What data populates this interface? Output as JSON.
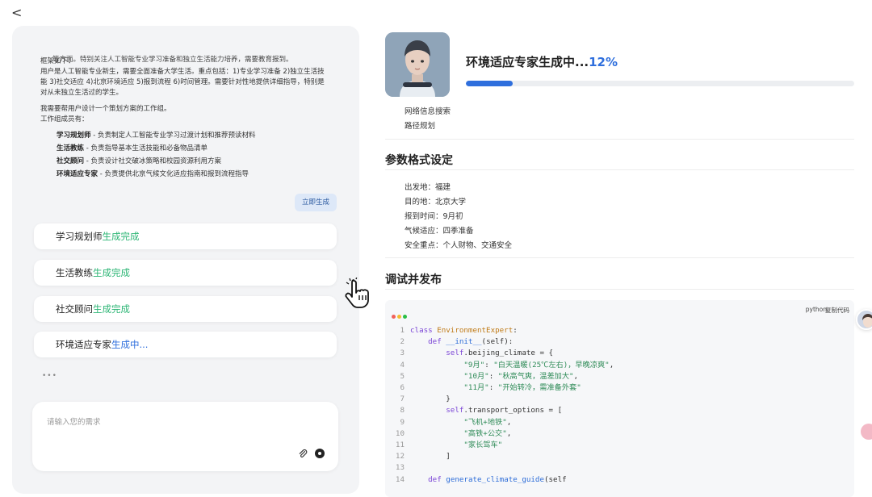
{
  "nav": {
    "back": "<"
  },
  "chat": {
    "cut_text": "等方面。特别关注人工智能专业学习准备和独立生活能力培养，需要教育报到。",
    "paragraphs": [
      "框架如下：\n用户是人工智能专业新生，需要全面准备大学生活。重点包括：1)专业学习准备 2)独立生活技能 3)社交适应 4)北京环境适应 5)报到流程 6)时间管理。需要针对性地提供详细指导，特别是对从未独立生活过的学生。",
      "我需要帮用户设计一个策划方案的工作组。\n工作组成员有："
    ],
    "members": [
      {
        "name": "学习规划师",
        "desc": " - 负责制定人工智能专业学习过渡计划和推荐预读材料"
      },
      {
        "name": "生活教练",
        "desc": " - 负责指导基本生活技能和必备物品清单"
      },
      {
        "name": "社交顾问",
        "desc": " - 负责设计社交破冰策略和校园资源利用方案"
      },
      {
        "name": "环境适应专家",
        "desc": " - 负责提供北京气候文化适应指南和报到流程指导"
      }
    ],
    "generate_button": "立即生成",
    "agents": [
      {
        "name": "学习规划师",
        "status": "生成完成",
        "state": "done"
      },
      {
        "name": "生活教练",
        "status": "生成完成",
        "state": "done"
      },
      {
        "name": "社交顾问",
        "status": "生成完成",
        "state": "done"
      },
      {
        "name": "环境适应专家",
        "status": "生成中...",
        "state": "running"
      }
    ],
    "typing": "•••",
    "input_placeholder": "请输入您的需求"
  },
  "progress": {
    "title": "环境适应专家生成中...",
    "percent_label": "12%",
    "value": 0.12,
    "tools": [
      "网络信息搜索",
      "路径规划"
    ]
  },
  "params": {
    "title": "参数格式设定",
    "items": [
      "出发地：福建",
      "目的地：北京大学",
      "报到时间：9月初",
      "气候适应：四季准备",
      "安全重点：个人财物、交通安全"
    ]
  },
  "debug": {
    "title": "调试并发布",
    "lang": "python",
    "copy_label": "复制代码",
    "traffic_colors": [
      "#f0625b",
      "#f5bc2f",
      "#2bbf47"
    ],
    "lines": [
      [
        [
          "kw",
          "class "
        ],
        [
          "cls",
          "EnvironmentExpert"
        ],
        [
          "plain",
          ":"
        ]
      ],
      [
        [
          "plain",
          "    "
        ],
        [
          "kw",
          "def "
        ],
        [
          "fn",
          "__init__"
        ],
        [
          "plain",
          "(self):"
        ]
      ],
      [
        [
          "plain",
          "        "
        ],
        [
          "kw",
          "self"
        ],
        [
          "plain",
          ".beijing_climate = {"
        ]
      ],
      [
        [
          "plain",
          "            "
        ],
        [
          "str",
          "\"9月\""
        ],
        [
          "plain",
          ": "
        ],
        [
          "str",
          "\"白天温暖(25℃左右)，早晚凉爽\""
        ],
        [
          "plain",
          ","
        ]
      ],
      [
        [
          "plain",
          "            "
        ],
        [
          "str",
          "\"10月\""
        ],
        [
          "plain",
          ": "
        ],
        [
          "str",
          "\"秋高气爽，温差加大\""
        ],
        [
          "plain",
          ","
        ]
      ],
      [
        [
          "plain",
          "            "
        ],
        [
          "str",
          "\"11月\""
        ],
        [
          "plain",
          ": "
        ],
        [
          "str",
          "\"开始转冷，需准备外套\""
        ]
      ],
      [
        [
          "plain",
          "        }"
        ]
      ],
      [
        [
          "plain",
          "        "
        ],
        [
          "kw",
          "self"
        ],
        [
          "plain",
          ".transport_options = ["
        ]
      ],
      [
        [
          "plain",
          "            "
        ],
        [
          "str",
          "\"飞机+地铁\""
        ],
        [
          "plain",
          ","
        ]
      ],
      [
        [
          "plain",
          "            "
        ],
        [
          "str",
          "\"高铁+公交\""
        ],
        [
          "plain",
          ","
        ]
      ],
      [
        [
          "plain",
          "            "
        ],
        [
          "str",
          "\"家长驾车\""
        ]
      ],
      [
        [
          "plain",
          "        ]"
        ]
      ],
      [
        [
          "plain",
          ""
        ]
      ],
      [
        [
          "plain",
          "    "
        ],
        [
          "kw",
          "def "
        ],
        [
          "fn",
          "generate_climate_guide"
        ],
        [
          "plain",
          "(self"
        ]
      ]
    ]
  }
}
